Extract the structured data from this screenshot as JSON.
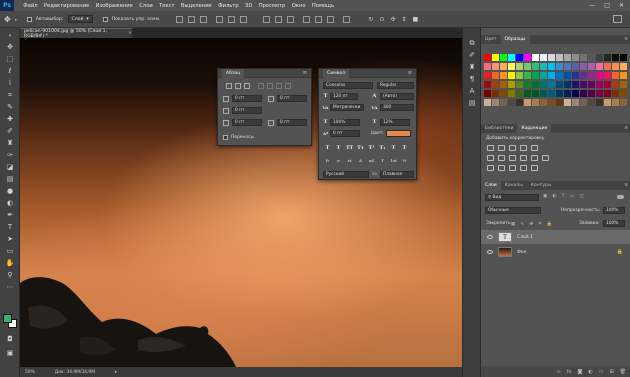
{
  "app": {
    "logo": "Ps"
  },
  "menu": [
    "Файл",
    "Редактирование",
    "Изображение",
    "Слои",
    "Текст",
    "Выделение",
    "Фильтр",
    "3D",
    "Просмотр",
    "Окно",
    "Помощь"
  ],
  "window_controls": [
    "—",
    "□",
    "✕"
  ],
  "options_bar": {
    "autoselect_label": "Автовыбор:",
    "autoselect_value": "Слой",
    "show_controls_label": "Показать упр. элем."
  },
  "document": {
    "tab_title": "pelican-901004.jpg @ 50% (Слой 1, RGB/8#) *",
    "close": "×"
  },
  "status": {
    "zoom": "50%",
    "doc_size": "Док: 34,9M/34,9M"
  },
  "paragraph_panel": {
    "title": "Абзац",
    "fields": [
      "0 пт",
      "0 пт",
      "0 пт",
      "0 пт",
      "0 пт"
    ],
    "hyphenation_label": "Переносы"
  },
  "character_panel": {
    "title": "Символ",
    "font_family": "Consolas",
    "font_style": "Regular",
    "font_size": "120 пт",
    "leading": "(Авто)",
    "kerning": "Метрически",
    "tracking": "300",
    "vertical_scale": "100%",
    "horizontal_scale": "12%",
    "baseline_shift": "0 пт",
    "color_label": "Цвет:",
    "color_value": "#e8884e",
    "style_buttons": [
      "T",
      "T",
      "TT",
      "Tт",
      "T¹",
      "T₁",
      "T",
      "T"
    ],
    "ot_buttons": [
      "fi",
      "σ",
      "st",
      "A",
      "ad",
      "T",
      "1st",
      "½"
    ],
    "language": "Русский",
    "antialias": "Плавное"
  },
  "right_panel": {
    "top_tabs": [
      "Цвет",
      "Образцы"
    ],
    "adj_tabs": [
      "Библиотеки",
      "Коррекция"
    ],
    "adj_title": "Добавить корректировку",
    "layers_tabs": [
      "Слои",
      "Каналы",
      "Контуры"
    ],
    "filter_kind": "Вид",
    "blend_mode": "Обычные",
    "opacity_label": "Непрозрачность:",
    "opacity_value": "100%",
    "lock_label": "Закрепить:",
    "fill_label": "Заливка:",
    "fill_value": "100%",
    "layers": [
      {
        "name": "Слой 1",
        "selected": true
      },
      {
        "name": "Фон",
        "selected": false
      }
    ]
  },
  "swatch_colors": [
    [
      "#ff0000",
      "#ffff00",
      "#00ff00",
      "#00ffff",
      "#0000ff",
      "#ff00ff",
      "#ffffff",
      "#f2f2f2",
      "#d9d9d9",
      "#bfbfbf",
      "#a6a6a6",
      "#8c8c8c",
      "#737373",
      "#595959",
      "#404040",
      "#262626",
      "#0d0d0d",
      "#000000"
    ],
    [
      "#f26d7d",
      "#f69679",
      "#fbaf5d",
      "#fff568",
      "#acd373",
      "#7cc576",
      "#3bb878",
      "#1abbb4",
      "#00bff3",
      "#438ccb",
      "#5574b9",
      "#605ca8",
      "#855fa8",
      "#a763a8",
      "#f06ea9",
      "#f26c4f",
      "#f68e56",
      "#fbaf5c"
    ],
    [
      "#ed1c24",
      "#f26522",
      "#f7941d",
      "#fff200",
      "#8dc63f",
      "#39b54a",
      "#00a651",
      "#00a99d",
      "#00aeef",
      "#0072bc",
      "#0054a6",
      "#2e3192",
      "#662d91",
      "#92278f",
      "#ec008c",
      "#ed145b",
      "#f26522",
      "#f7941d"
    ],
    [
      "#9e0b0f",
      "#a0410d",
      "#a3620a",
      "#aba000",
      "#598527",
      "#197b30",
      "#007236",
      "#00746b",
      "#0076a3",
      "#004a80",
      "#003471",
      "#1b1464",
      "#440e62",
      "#630460",
      "#9e005d",
      "#9e0039",
      "#a0410d",
      "#a3620a"
    ],
    [
      "#790000",
      "#7b2e00",
      "#7d4900",
      "#827b00",
      "#406618",
      "#005e20",
      "#005826",
      "#005952",
      "#005b7f",
      "#003663",
      "#002157",
      "#0d004c",
      "#32004b",
      "#4b0049",
      "#7b0046",
      "#7a0026",
      "#7b2e00",
      "#7d4900"
    ],
    [
      "#c7b299",
      "#998675",
      "#736357",
      "#534741",
      "#37302d",
      "#c69c6d",
      "#a67c52",
      "#8c6239",
      "#754c24",
      "#603913",
      "#c7b299",
      "#998675",
      "#736357",
      "#534741",
      "#37302d",
      "#c69c6d",
      "#a67c52",
      "#8c6239"
    ]
  ]
}
